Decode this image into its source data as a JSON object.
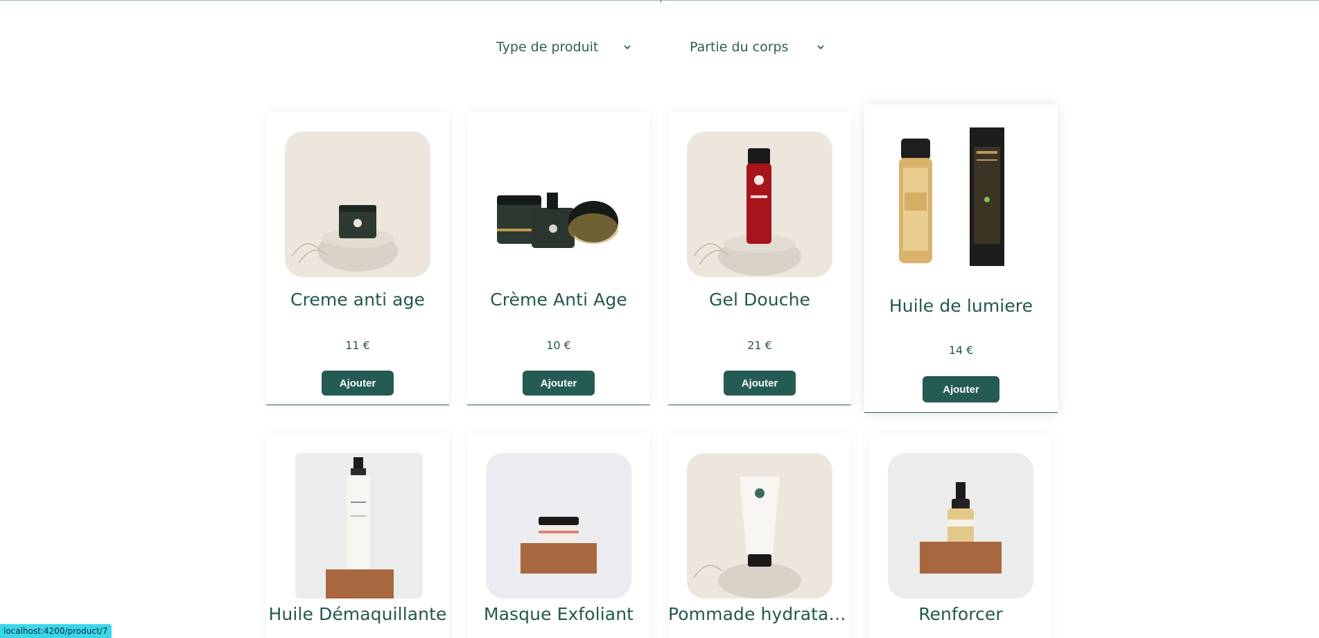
{
  "filters": {
    "product_type": "Type de produit",
    "body_part": "Partie du corps",
    "chevron_icon": "chevron-down-icon"
  },
  "products": [
    {
      "name": "Creme anti age",
      "price": "11 €",
      "button": "Ajouter"
    },
    {
      "name": "Crème Anti Age",
      "price": "10 €",
      "button": "Ajouter"
    },
    {
      "name": "Gel Douche",
      "price": "21 €",
      "button": "Ajouter"
    },
    {
      "name": "Huile de lumiere",
      "price": "14 €",
      "button": "Ajouter"
    },
    {
      "name": "Huile Démaquillante",
      "price": "",
      "button": ""
    },
    {
      "name": "Masque Exfoliant",
      "price": "",
      "button": ""
    },
    {
      "name": "Pommade hydratante",
      "price": "",
      "button": ""
    },
    {
      "name": "Renforcer",
      "price": "",
      "button": ""
    }
  ],
  "status_bar": {
    "url": "localhost:4200/product/7"
  },
  "colors": {
    "accent": "#245c53",
    "text": "#24574e",
    "status_bar": "#3cd6ea"
  }
}
